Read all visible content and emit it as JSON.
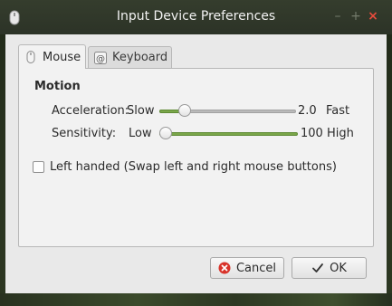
{
  "window": {
    "title": "Input Device Preferences",
    "controls": {
      "minimize": "–",
      "maximize": "+",
      "close": "×"
    }
  },
  "tabs": [
    {
      "label": "Mouse",
      "icon": "mouse-icon",
      "active": true
    },
    {
      "label": "Keyboard",
      "icon": "keyboard-icon",
      "active": false
    }
  ],
  "motion": {
    "heading": "Motion",
    "acceleration": {
      "label": "Acceleration:",
      "min_label": "Slow",
      "value": "2.0",
      "max_label": "Fast",
      "fraction": 0.15
    },
    "sensitivity": {
      "label": "Sensitivity:",
      "min_label": "Low",
      "value": "100",
      "max_label": "High",
      "fraction": 0.0
    }
  },
  "left_handed": {
    "label": "Left handed (Swap left and right mouse buttons)",
    "checked": false
  },
  "buttons": {
    "cancel": {
      "label": "Cancel",
      "icon": "cancel-icon"
    },
    "ok": {
      "label": "OK",
      "icon": "check-icon"
    }
  },
  "colors": {
    "accent": "#7aa649",
    "close": "#e74b3c",
    "titlebar": "#2f362a"
  }
}
